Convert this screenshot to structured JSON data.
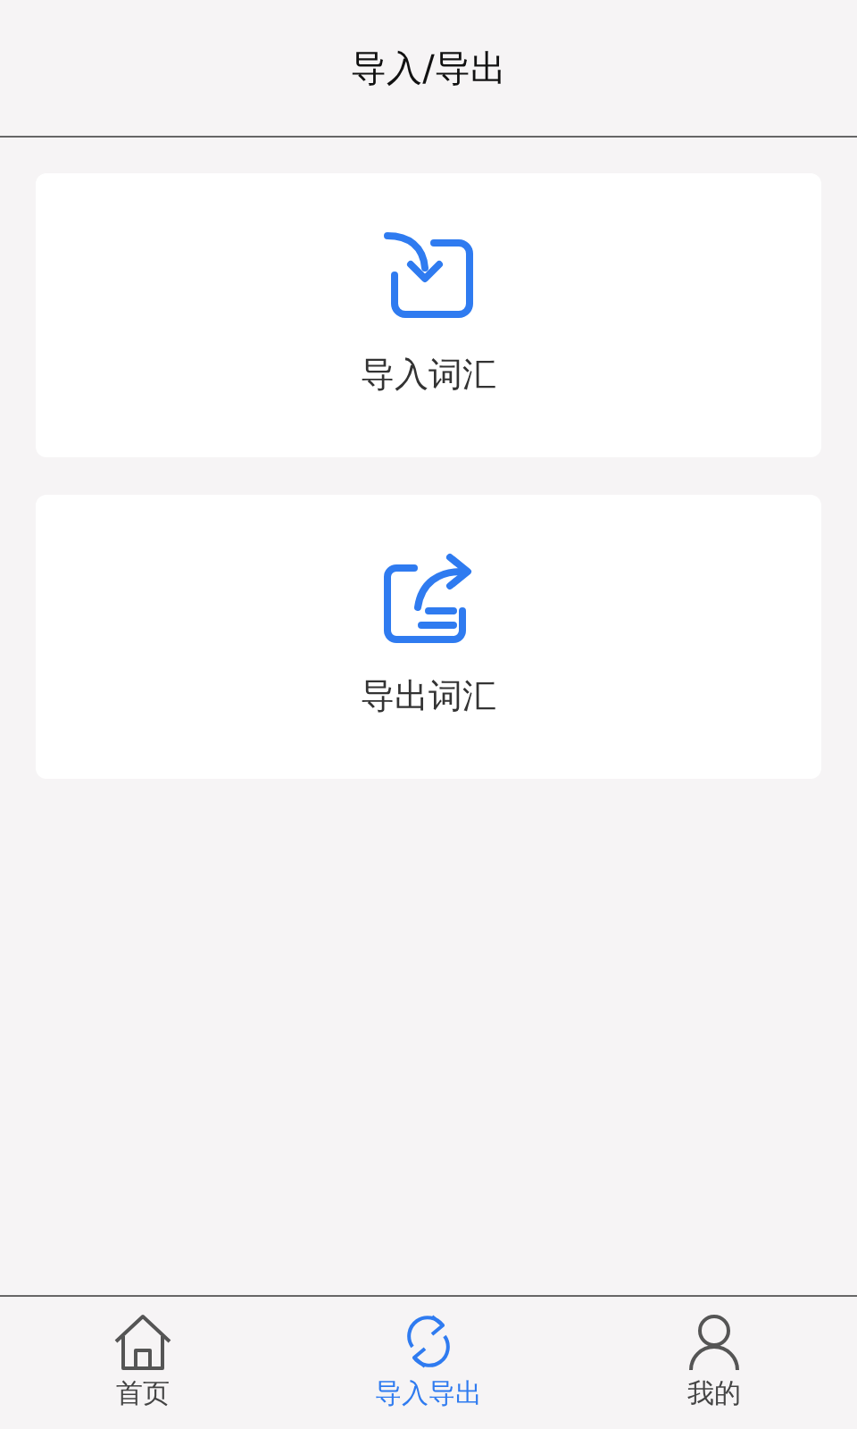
{
  "header": {
    "title": "导入/导出"
  },
  "actions": [
    {
      "kind": "import",
      "label": "导入词汇"
    },
    {
      "kind": "export",
      "label": "导出词汇"
    }
  ],
  "tab_bar": [
    {
      "kind": "home",
      "label": "首页",
      "selected": false
    },
    {
      "kind": "sync",
      "label": "导入导出",
      "selected": true
    },
    {
      "kind": "user",
      "label": "我的",
      "selected": false
    }
  ]
}
